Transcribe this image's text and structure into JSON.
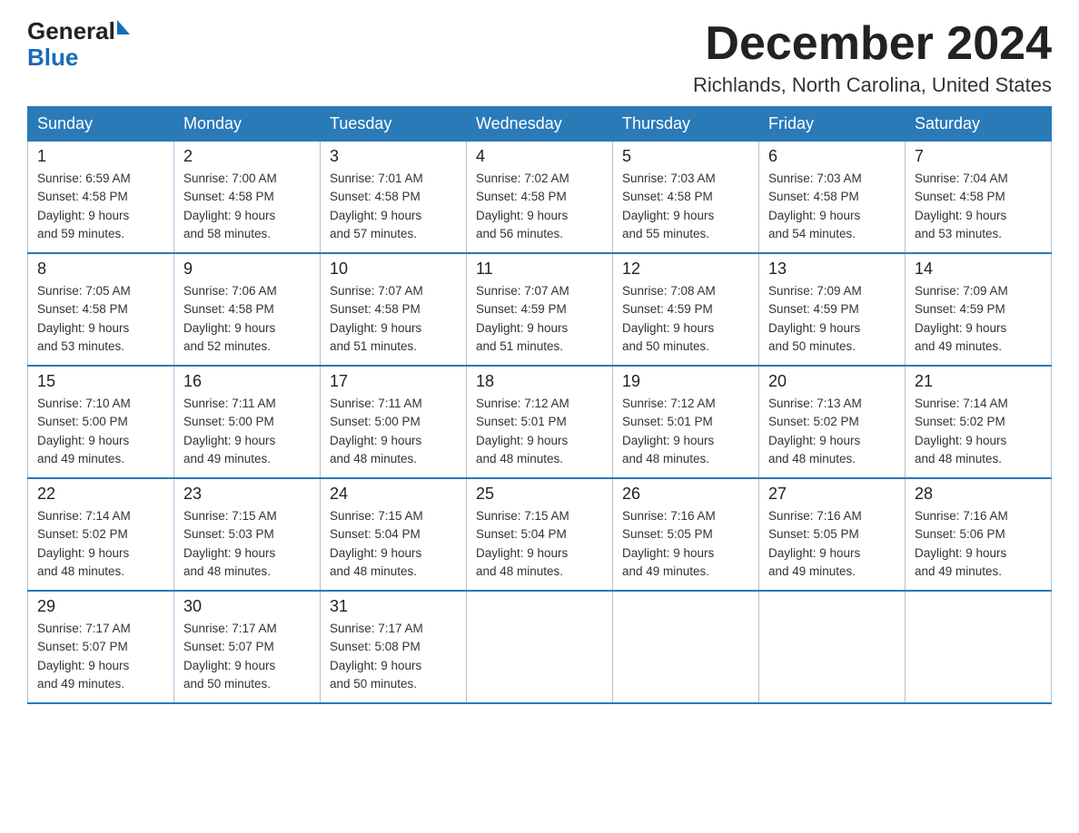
{
  "header": {
    "logo": {
      "text_general": "General",
      "text_blue": "Blue",
      "triangle": "▲"
    },
    "month_title": "December 2024",
    "location": "Richlands, North Carolina, United States"
  },
  "weekdays": [
    "Sunday",
    "Monday",
    "Tuesday",
    "Wednesday",
    "Thursday",
    "Friday",
    "Saturday"
  ],
  "weeks": [
    [
      {
        "day": "1",
        "sunrise": "Sunrise: 6:59 AM",
        "sunset": "Sunset: 4:58 PM",
        "daylight": "Daylight: 9 hours",
        "daylight2": "and 59 minutes."
      },
      {
        "day": "2",
        "sunrise": "Sunrise: 7:00 AM",
        "sunset": "Sunset: 4:58 PM",
        "daylight": "Daylight: 9 hours",
        "daylight2": "and 58 minutes."
      },
      {
        "day": "3",
        "sunrise": "Sunrise: 7:01 AM",
        "sunset": "Sunset: 4:58 PM",
        "daylight": "Daylight: 9 hours",
        "daylight2": "and 57 minutes."
      },
      {
        "day": "4",
        "sunrise": "Sunrise: 7:02 AM",
        "sunset": "Sunset: 4:58 PM",
        "daylight": "Daylight: 9 hours",
        "daylight2": "and 56 minutes."
      },
      {
        "day": "5",
        "sunrise": "Sunrise: 7:03 AM",
        "sunset": "Sunset: 4:58 PM",
        "daylight": "Daylight: 9 hours",
        "daylight2": "and 55 minutes."
      },
      {
        "day": "6",
        "sunrise": "Sunrise: 7:03 AM",
        "sunset": "Sunset: 4:58 PM",
        "daylight": "Daylight: 9 hours",
        "daylight2": "and 54 minutes."
      },
      {
        "day": "7",
        "sunrise": "Sunrise: 7:04 AM",
        "sunset": "Sunset: 4:58 PM",
        "daylight": "Daylight: 9 hours",
        "daylight2": "and 53 minutes."
      }
    ],
    [
      {
        "day": "8",
        "sunrise": "Sunrise: 7:05 AM",
        "sunset": "Sunset: 4:58 PM",
        "daylight": "Daylight: 9 hours",
        "daylight2": "and 53 minutes."
      },
      {
        "day": "9",
        "sunrise": "Sunrise: 7:06 AM",
        "sunset": "Sunset: 4:58 PM",
        "daylight": "Daylight: 9 hours",
        "daylight2": "and 52 minutes."
      },
      {
        "day": "10",
        "sunrise": "Sunrise: 7:07 AM",
        "sunset": "Sunset: 4:58 PM",
        "daylight": "Daylight: 9 hours",
        "daylight2": "and 51 minutes."
      },
      {
        "day": "11",
        "sunrise": "Sunrise: 7:07 AM",
        "sunset": "Sunset: 4:59 PM",
        "daylight": "Daylight: 9 hours",
        "daylight2": "and 51 minutes."
      },
      {
        "day": "12",
        "sunrise": "Sunrise: 7:08 AM",
        "sunset": "Sunset: 4:59 PM",
        "daylight": "Daylight: 9 hours",
        "daylight2": "and 50 minutes."
      },
      {
        "day": "13",
        "sunrise": "Sunrise: 7:09 AM",
        "sunset": "Sunset: 4:59 PM",
        "daylight": "Daylight: 9 hours",
        "daylight2": "and 50 minutes."
      },
      {
        "day": "14",
        "sunrise": "Sunrise: 7:09 AM",
        "sunset": "Sunset: 4:59 PM",
        "daylight": "Daylight: 9 hours",
        "daylight2": "and 49 minutes."
      }
    ],
    [
      {
        "day": "15",
        "sunrise": "Sunrise: 7:10 AM",
        "sunset": "Sunset: 5:00 PM",
        "daylight": "Daylight: 9 hours",
        "daylight2": "and 49 minutes."
      },
      {
        "day": "16",
        "sunrise": "Sunrise: 7:11 AM",
        "sunset": "Sunset: 5:00 PM",
        "daylight": "Daylight: 9 hours",
        "daylight2": "and 49 minutes."
      },
      {
        "day": "17",
        "sunrise": "Sunrise: 7:11 AM",
        "sunset": "Sunset: 5:00 PM",
        "daylight": "Daylight: 9 hours",
        "daylight2": "and 48 minutes."
      },
      {
        "day": "18",
        "sunrise": "Sunrise: 7:12 AM",
        "sunset": "Sunset: 5:01 PM",
        "daylight": "Daylight: 9 hours",
        "daylight2": "and 48 minutes."
      },
      {
        "day": "19",
        "sunrise": "Sunrise: 7:12 AM",
        "sunset": "Sunset: 5:01 PM",
        "daylight": "Daylight: 9 hours",
        "daylight2": "and 48 minutes."
      },
      {
        "day": "20",
        "sunrise": "Sunrise: 7:13 AM",
        "sunset": "Sunset: 5:02 PM",
        "daylight": "Daylight: 9 hours",
        "daylight2": "and 48 minutes."
      },
      {
        "day": "21",
        "sunrise": "Sunrise: 7:14 AM",
        "sunset": "Sunset: 5:02 PM",
        "daylight": "Daylight: 9 hours",
        "daylight2": "and 48 minutes."
      }
    ],
    [
      {
        "day": "22",
        "sunrise": "Sunrise: 7:14 AM",
        "sunset": "Sunset: 5:02 PM",
        "daylight": "Daylight: 9 hours",
        "daylight2": "and 48 minutes."
      },
      {
        "day": "23",
        "sunrise": "Sunrise: 7:15 AM",
        "sunset": "Sunset: 5:03 PM",
        "daylight": "Daylight: 9 hours",
        "daylight2": "and 48 minutes."
      },
      {
        "day": "24",
        "sunrise": "Sunrise: 7:15 AM",
        "sunset": "Sunset: 5:04 PM",
        "daylight": "Daylight: 9 hours",
        "daylight2": "and 48 minutes."
      },
      {
        "day": "25",
        "sunrise": "Sunrise: 7:15 AM",
        "sunset": "Sunset: 5:04 PM",
        "daylight": "Daylight: 9 hours",
        "daylight2": "and 48 minutes."
      },
      {
        "day": "26",
        "sunrise": "Sunrise: 7:16 AM",
        "sunset": "Sunset: 5:05 PM",
        "daylight": "Daylight: 9 hours",
        "daylight2": "and 49 minutes."
      },
      {
        "day": "27",
        "sunrise": "Sunrise: 7:16 AM",
        "sunset": "Sunset: 5:05 PM",
        "daylight": "Daylight: 9 hours",
        "daylight2": "and 49 minutes."
      },
      {
        "day": "28",
        "sunrise": "Sunrise: 7:16 AM",
        "sunset": "Sunset: 5:06 PM",
        "daylight": "Daylight: 9 hours",
        "daylight2": "and 49 minutes."
      }
    ],
    [
      {
        "day": "29",
        "sunrise": "Sunrise: 7:17 AM",
        "sunset": "Sunset: 5:07 PM",
        "daylight": "Daylight: 9 hours",
        "daylight2": "and 49 minutes."
      },
      {
        "day": "30",
        "sunrise": "Sunrise: 7:17 AM",
        "sunset": "Sunset: 5:07 PM",
        "daylight": "Daylight: 9 hours",
        "daylight2": "and 50 minutes."
      },
      {
        "day": "31",
        "sunrise": "Sunrise: 7:17 AM",
        "sunset": "Sunset: 5:08 PM",
        "daylight": "Daylight: 9 hours",
        "daylight2": "and 50 minutes."
      },
      null,
      null,
      null,
      null
    ]
  ]
}
